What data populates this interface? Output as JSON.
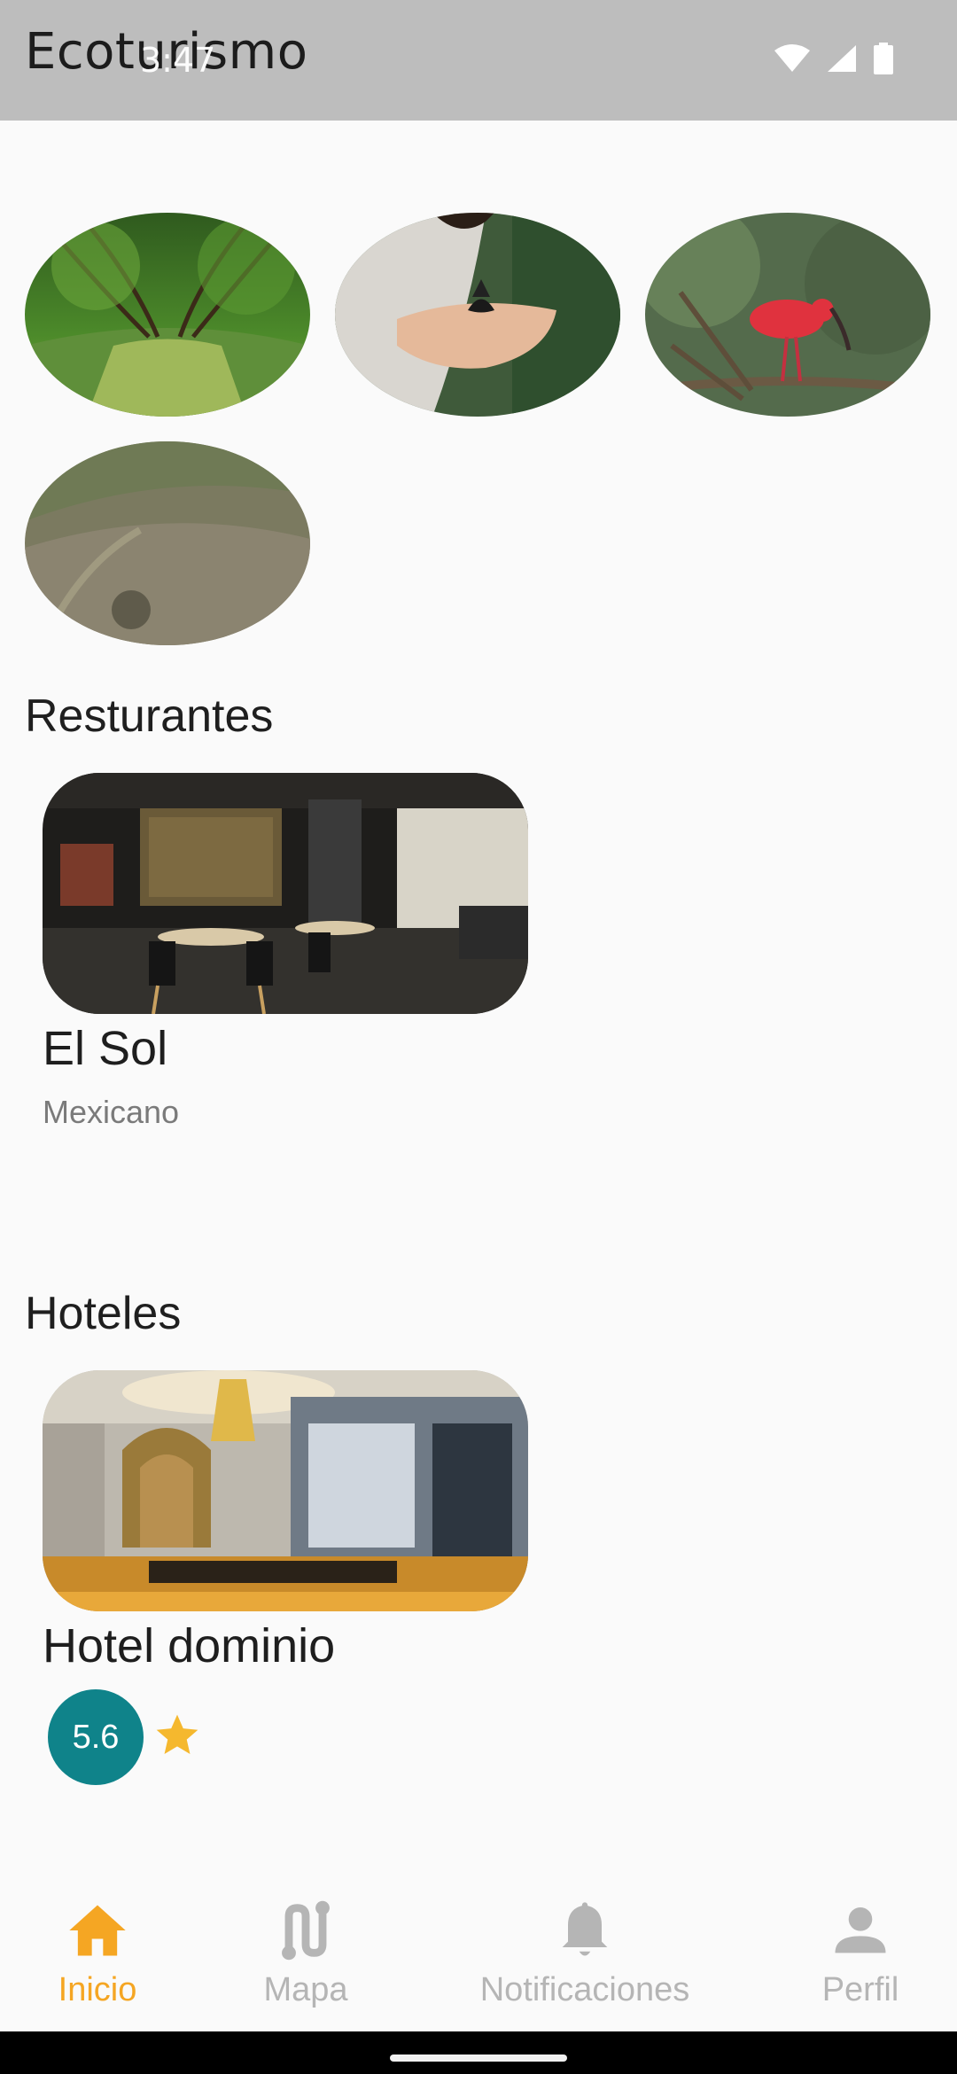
{
  "app_bar": {
    "title": "Ecoturismo"
  },
  "status_bar": {
    "time": "3:47",
    "icons": [
      "wifi-icon",
      "signal-icon",
      "battery-icon"
    ]
  },
  "gallery": {
    "items": [
      {
        "name": "mangrove-river-photo"
      },
      {
        "name": "butterfly-in-hands-photo"
      },
      {
        "name": "scarlet-ibis-photo"
      },
      {
        "name": "hills-aerial-photo"
      }
    ]
  },
  "restaurants": {
    "title": "Resturantes",
    "items": [
      {
        "name": "El Sol",
        "type": "Mexicano"
      }
    ]
  },
  "hotels": {
    "title": "Hoteles",
    "items": [
      {
        "name": "Hotel dominio",
        "rating": "5.6"
      }
    ]
  },
  "bottom_nav": {
    "items": [
      {
        "label": "Inicio",
        "icon": "home-icon",
        "active": true
      },
      {
        "label": "Mapa",
        "icon": "route-icon",
        "active": false
      },
      {
        "label": "Notificaciones",
        "icon": "bell-icon",
        "active": false
      },
      {
        "label": "Perfil",
        "icon": "person-icon",
        "active": false
      }
    ]
  },
  "colors": {
    "app_bar": "#bdbdbd",
    "accent_active": "#f5a623",
    "inactive": "#b5b5b5",
    "rating_badge": "#0f838a",
    "star": "#f5b82e"
  }
}
